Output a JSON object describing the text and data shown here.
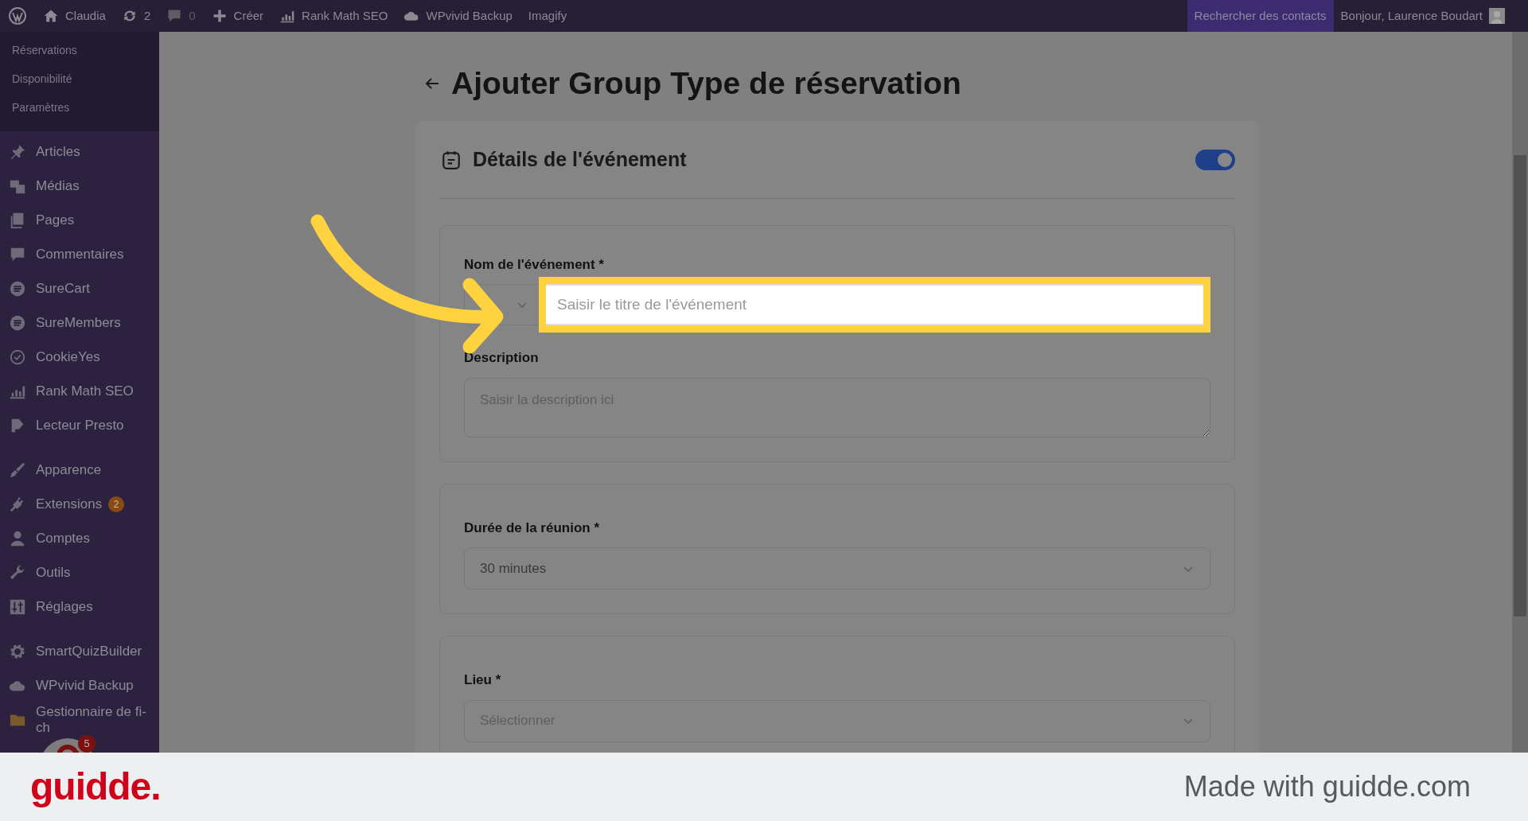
{
  "admin_bar": {
    "items": [
      {
        "kind": "wp"
      },
      {
        "kind": "home",
        "label": "Claudia"
      },
      {
        "kind": "updates",
        "label": "2"
      },
      {
        "kind": "comments",
        "label": "0"
      },
      {
        "kind": "plus",
        "label": "Créer"
      },
      {
        "kind": "chart",
        "label": "Rank Math SEO"
      },
      {
        "kind": "cloud",
        "label": "WPvivid Backup"
      },
      {
        "kind": "none",
        "label": "Imagify"
      }
    ],
    "search": "Rechercher des contacts",
    "greeting": "Bonjour, Laurence Boudart"
  },
  "sidebar": {
    "submenu": [
      "Réservations",
      "Disponibilité",
      "Paramètres"
    ],
    "groups": [
      [
        {
          "label": "Articles"
        },
        {
          "label": "Médias"
        },
        {
          "label": "Pages"
        },
        {
          "label": "Commentaires"
        },
        {
          "label": "SureCart"
        },
        {
          "label": "SureMembers"
        },
        {
          "label": "CookieYes"
        },
        {
          "label": "Rank Math SEO"
        },
        {
          "label": "Lecteur Presto"
        }
      ],
      [
        {
          "label": "Apparence"
        },
        {
          "label": "Extensions",
          "badge": "2"
        },
        {
          "label": "Comptes"
        },
        {
          "label": "Outils"
        },
        {
          "label": "Réglages"
        }
      ],
      [
        {
          "label": "SmartQuizBuilder"
        },
        {
          "label": "WPvivid Backup"
        },
        {
          "label": "Gestionnaire de fi-ch"
        }
      ]
    ],
    "chat_badge": "5"
  },
  "page": {
    "title": "Ajouter Group Type de réservation",
    "card": {
      "title": "Détails de l'événement",
      "toggle_on": true,
      "sections": [
        [
          {
            "kind": "input",
            "label": "Nom de l'événement *",
            "placeholder": "Saisir le titre de l'événement",
            "highlighted": true
          },
          {
            "kind": "textarea",
            "label": "Description",
            "placeholder": "Saisir la description ici"
          }
        ],
        [
          {
            "kind": "select",
            "label": "Durée de la réunion *",
            "value": "30 minutes"
          }
        ],
        [
          {
            "kind": "select",
            "label": "Lieu *",
            "placeholder": "Sélectionner"
          }
        ]
      ]
    }
  },
  "footer": {
    "logo": "guidde.",
    "credit": "Made with guidde.com"
  }
}
